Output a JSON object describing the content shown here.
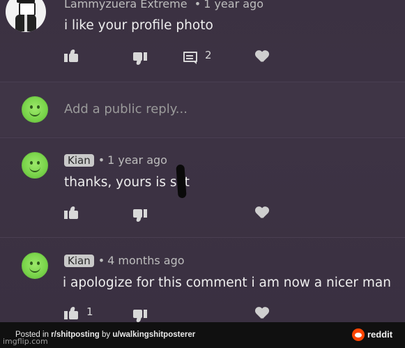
{
  "comment_top": {
    "author": "Lammyzuera Extreme",
    "time": "1 year ago",
    "text": "i like your profile photo",
    "reply_count": "2"
  },
  "reply_box": {
    "placeholder": "Add a public reply..."
  },
  "reply_1": {
    "author": "Kian",
    "time": "1 year ago",
    "text": "thanks, yours is s it"
  },
  "reply_2": {
    "author": "Kian",
    "time": "4 months ago",
    "text": "i apologize for this comment i am now a nicer man",
    "like_count": "1"
  },
  "footer": {
    "posted_prefix": "Posted in ",
    "subreddit": "r/shitposting",
    "by": " by ",
    "user": "u/walkingshitposterer",
    "brand": "reddit"
  },
  "watermark": "imgflip.com",
  "icons": [
    "thumb-up-icon",
    "thumb-down-icon",
    "reply-icon",
    "heart-icon",
    "reddit-logo-icon"
  ],
  "colors": {
    "background": "#3b3142",
    "footer": "#101010",
    "avatar_green": "#79d44a",
    "reddit_orange": "#ff4500"
  }
}
